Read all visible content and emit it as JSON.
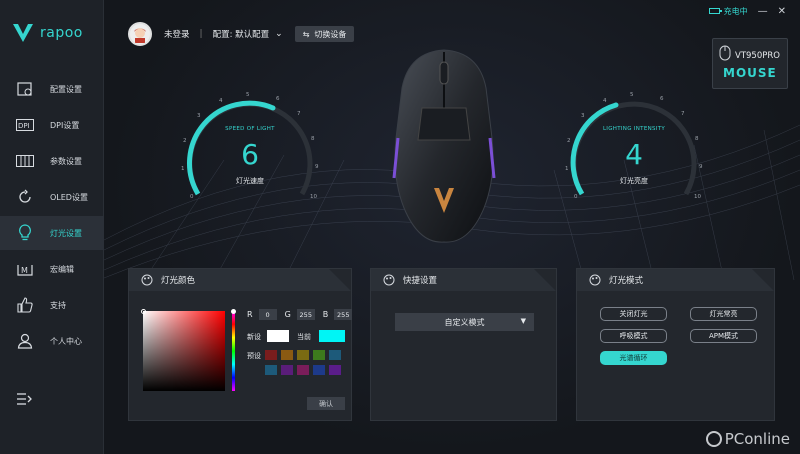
{
  "app": {
    "brand": "rapoo",
    "accent": "#35d6cf"
  },
  "window": {
    "charging": "充电中",
    "minimize": "—",
    "close": "✕"
  },
  "sidebar": {
    "items": [
      {
        "label": "配置设置",
        "icon": "config-icon"
      },
      {
        "label": "DPI设置",
        "icon": "dpi-icon"
      },
      {
        "label": "参数设置",
        "icon": "sliders-icon"
      },
      {
        "label": "OLED设置",
        "icon": "refresh-icon"
      },
      {
        "label": "灯光设置",
        "icon": "bulb-icon",
        "active": true
      },
      {
        "label": "宏编辑",
        "icon": "macro-icon"
      },
      {
        "label": "支持",
        "icon": "thumbs-up-icon"
      },
      {
        "label": "个人中心",
        "icon": "user-icon"
      }
    ]
  },
  "topbar": {
    "user": "未登录",
    "separator": "|",
    "config": "配置: 默认配置",
    "switch_device": "切换设备"
  },
  "device": {
    "model": "VT950PRO",
    "type": "MOUSE"
  },
  "gauges": {
    "speed": {
      "caption": "SPEED OF LIGHT",
      "value": "6",
      "label": "灯光速度",
      "min": "0",
      "max": "10",
      "ticks": [
        "0",
        "1",
        "2",
        "3",
        "4",
        "5",
        "6",
        "7",
        "8",
        "9",
        "10"
      ]
    },
    "intensity": {
      "caption": "LIGHTING INTENSITY",
      "value": "4",
      "label": "灯光亮度",
      "min": "0",
      "max": "10",
      "ticks": [
        "0",
        "1",
        "2",
        "3",
        "4",
        "5",
        "6",
        "7",
        "8",
        "9",
        "10"
      ]
    }
  },
  "color_panel": {
    "title": "灯光颜色",
    "r_label": "R",
    "r": "0",
    "g_label": "G",
    "g": "255",
    "b_label": "B",
    "b": "255",
    "new_label": "新设",
    "new_color": "#ffffff",
    "current_label": "当前",
    "current_color": "#00f5f5",
    "preset_label": "预设",
    "presets": [
      "#7a1d1d",
      "#8a5a12",
      "#7a6a12",
      "#3d7a1d",
      "#1d5a7a",
      "#1d5a7a",
      "#5a1d7a",
      "#7a1d5a",
      "#1d3a8a",
      "#5a1d8a"
    ],
    "confirm": "确认"
  },
  "quick_panel": {
    "title": "快捷设置",
    "select_value": "自定义模式"
  },
  "mode_panel": {
    "title": "灯光模式",
    "modes": [
      "关闭灯光",
      "灯光常亮",
      "呼吸模式",
      "APM模式",
      "光谱循环"
    ],
    "active": "光谱循环"
  },
  "watermark": "PConline"
}
